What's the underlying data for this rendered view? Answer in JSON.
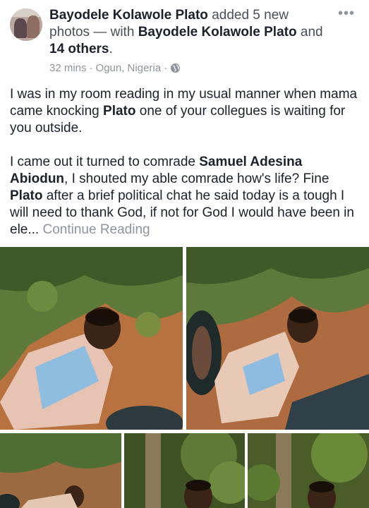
{
  "post": {
    "author": "Bayodele Kolawole Plato",
    "action": "added 5 new photos",
    "with_text": "— with",
    "tagged_name": "Bayodele Kolawole Plato",
    "and_text": "and",
    "others": "14 others",
    "period": ".",
    "time": "32 mins",
    "separator": "·",
    "location": "Ogun, Nigeria",
    "separator2": "·",
    "privacy_icon": "globe-icon",
    "more_icon": "•••"
  },
  "content": {
    "p1_a": "I was in my room reading in my usual manner when mama came knocking ",
    "p1_b": "Plato",
    "p1_c": " one of your collegues is waiting for you outside.",
    "p2_a": "I came out it turned to comrade ",
    "p2_b": "Samuel Adesina Abiodun",
    "p2_c": ", I shouted my able comrade how's life? Fine ",
    "p2_d": "Plato",
    "p2_e": " after a brief political chat he said today is a tough I will need to thank God, if not for God I would have been in ele... ",
    "continue": "Continue Reading"
  },
  "photos": [
    {
      "name": "photo-1",
      "desc": "photo"
    },
    {
      "name": "photo-2",
      "desc": "photo"
    },
    {
      "name": "photo-3",
      "desc": "photo"
    },
    {
      "name": "photo-4",
      "desc": "photo"
    },
    {
      "name": "photo-5",
      "desc": "photo"
    }
  ],
  "colors": {
    "text": "#1d2129",
    "meta": "#90949c",
    "soil": "#b56f3f",
    "foliage": "#4a5b2c"
  }
}
